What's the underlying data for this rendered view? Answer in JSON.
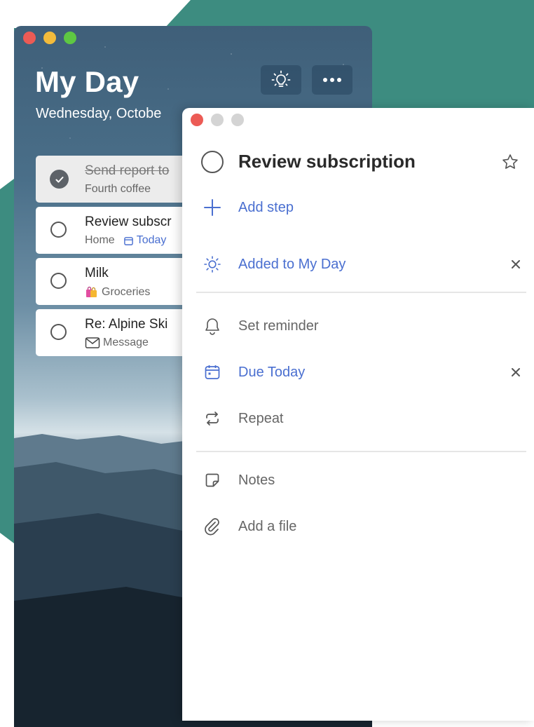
{
  "colors": {
    "accent": "#4a6fd0",
    "teal": "#3d8c80",
    "close": "#ec5b55"
  },
  "list_window": {
    "title": "My Day",
    "date": "Wednesday, Octobe",
    "header_icons": [
      "lightbulb-icon",
      "more-icon"
    ],
    "tasks": [
      {
        "title": "Send report to",
        "subtitle": "Fourth coffee",
        "completed": true
      },
      {
        "title": "Review subscr",
        "list": "Home",
        "due": "Today",
        "completed": false
      },
      {
        "title": "Milk",
        "list": "Groceries",
        "list_icon": "shopping-bag-icon",
        "completed": false
      },
      {
        "title": "Re: Alpine Ski",
        "list": "Message",
        "list_icon": "envelope-icon",
        "completed": false
      }
    ]
  },
  "detail_window": {
    "task_title": "Review subscription",
    "add_step": "Add step",
    "added_to_my_day": "Added to My Day",
    "set_reminder": "Set reminder",
    "due": "Due Today",
    "repeat": "Repeat",
    "notes": "Notes",
    "add_file": "Add a file"
  }
}
